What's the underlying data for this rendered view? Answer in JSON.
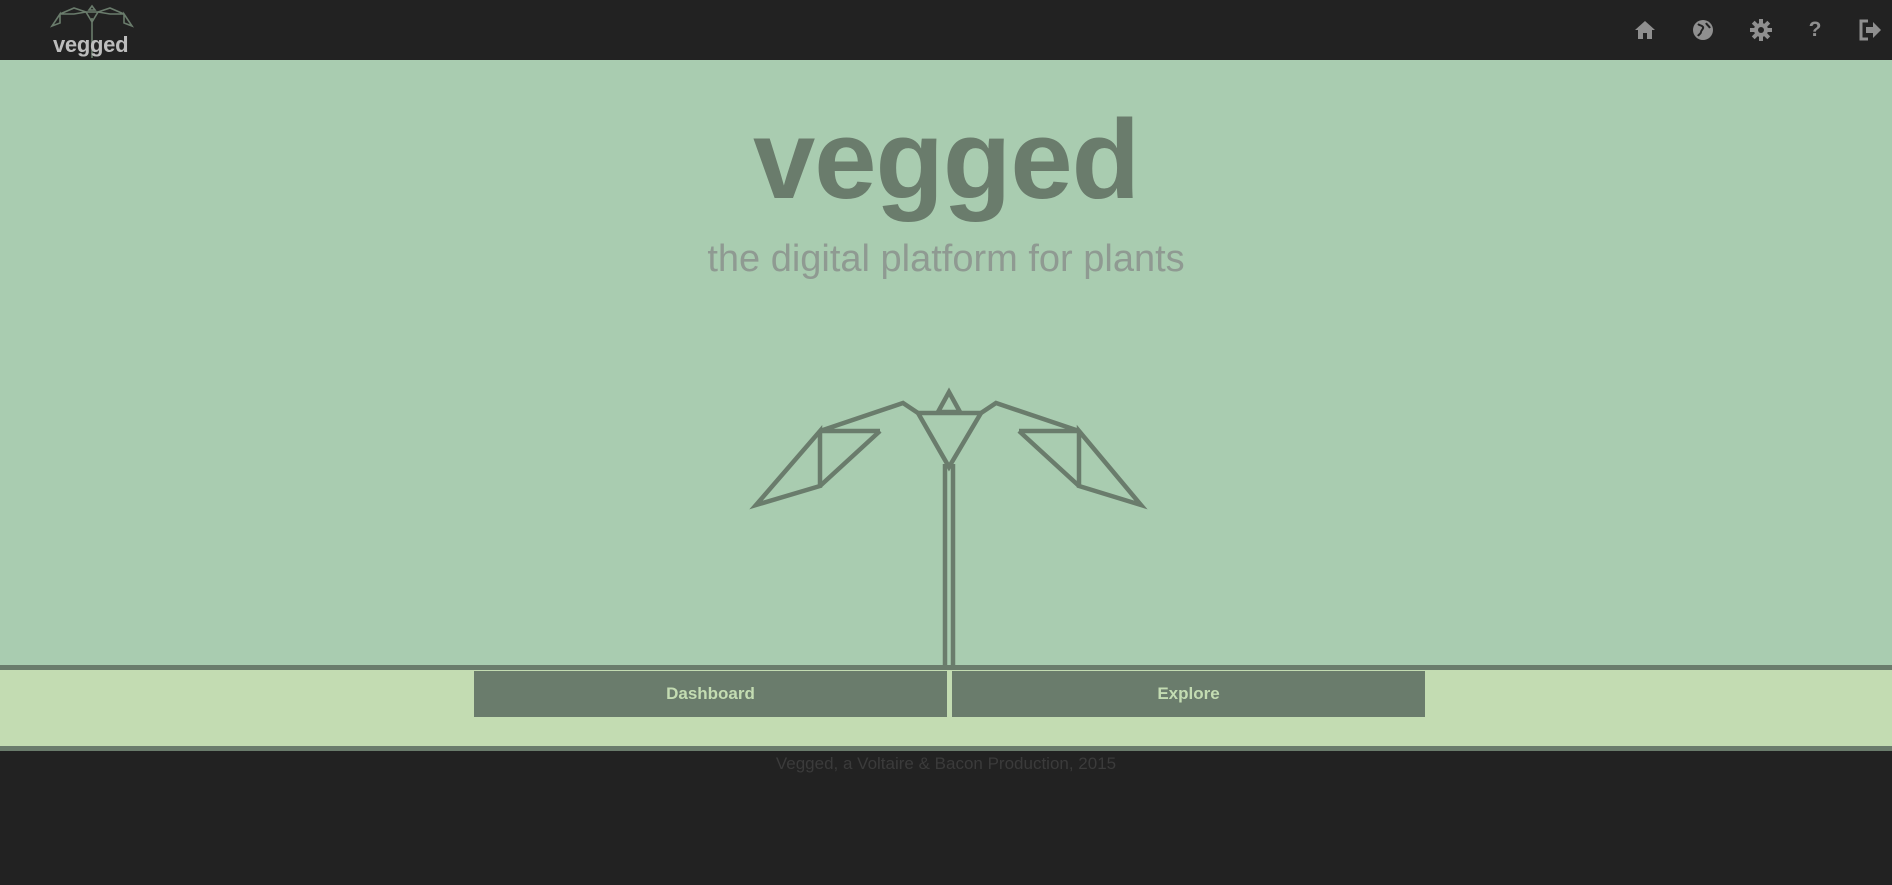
{
  "navbar": {
    "brand": "vegged",
    "icons": [
      {
        "name": "home-icon"
      },
      {
        "name": "globe-icon"
      },
      {
        "name": "gear-icon"
      },
      {
        "name": "help-icon",
        "glyph": "?"
      },
      {
        "name": "logout-icon"
      }
    ]
  },
  "hero": {
    "title": "vegged",
    "subtitle": "the digital platform for plants"
  },
  "actions": {
    "dashboard_label": "Dashboard",
    "explore_label": "Explore"
  },
  "footer": {
    "text": "Vegged, a Voltaire & Bacon Production, 2015"
  },
  "colors": {
    "navbar_bg": "#222222",
    "hero_bg": "#a9ccb0",
    "accent_dark": "#6a7c6c",
    "band_bg": "#c3dcb2",
    "nav_icon": "#8f8f8f"
  }
}
